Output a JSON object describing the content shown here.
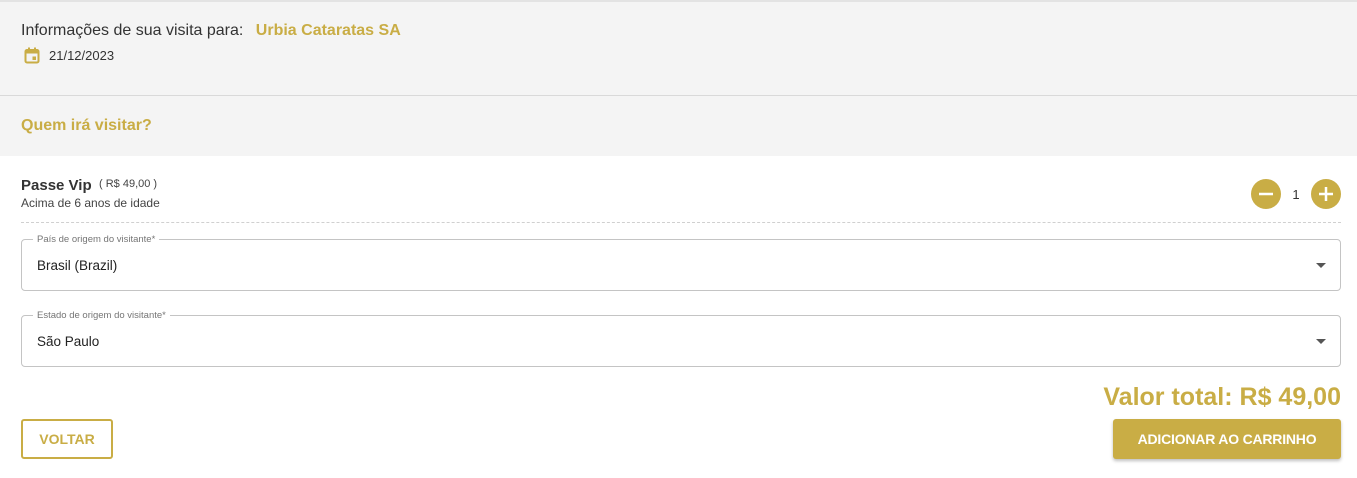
{
  "visit": {
    "label": "Informações de sua visita para:",
    "company": "Urbia Cataratas SA",
    "date": "21/12/2023",
    "date_icon": "calendar-icon"
  },
  "who": {
    "title": "Quem irá visitar?"
  },
  "ticket": {
    "name": "Passe Vip",
    "price": "( R$ 49,00 )",
    "description": "Acima de 6 anos de idade",
    "quantity": "1",
    "decrement_icon": "minus-circle-icon",
    "increment_icon": "plus-circle-icon"
  },
  "fields": {
    "country": {
      "label": "País de origem do visitante*",
      "value": "Brasil (Brazil)"
    },
    "state": {
      "label": "Estado de origem do visitante*",
      "value": "São Paulo"
    }
  },
  "total": "Valor total: R$ 49,00",
  "buttons": {
    "back": "VOLTAR",
    "add_to_cart": "ADICIONAR AO CARRINHO"
  },
  "colors": {
    "accent": "#c9ad45",
    "panel_bg": "#f4f4f4",
    "text": "#333333"
  }
}
